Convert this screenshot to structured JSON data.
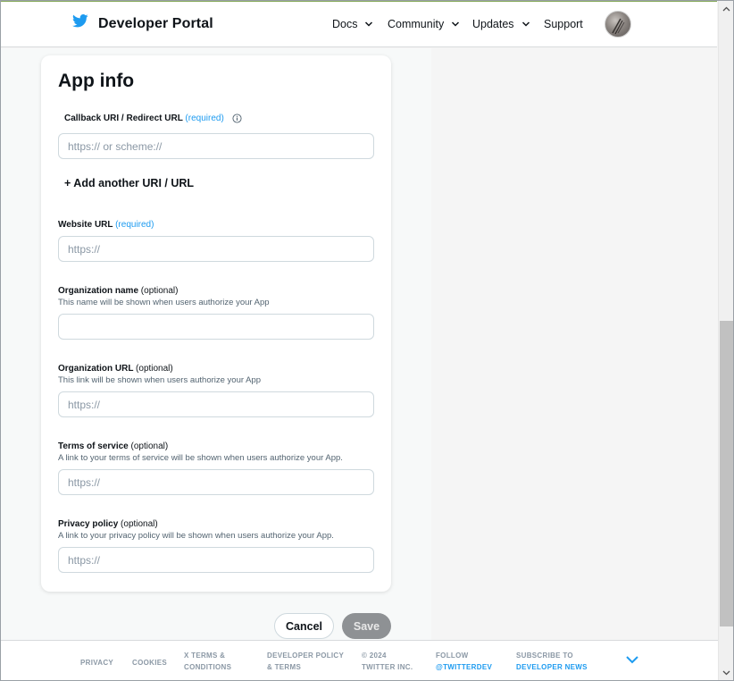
{
  "header": {
    "brand": "Developer Portal",
    "nav": [
      {
        "label": "Docs",
        "dropdown": true
      },
      {
        "label": "Community",
        "dropdown": true
      },
      {
        "label": "Updates",
        "dropdown": true
      },
      {
        "label": "Support",
        "dropdown": false
      }
    ],
    "logo_icon": "twitter-bird-icon",
    "avatar_icon": "user-avatar"
  },
  "form": {
    "title": "App info",
    "callback": {
      "label": "Callback URI / Redirect URL",
      "required": "(required)",
      "placeholder": "https:// or scheme://",
      "value": "",
      "info_icon": "info-icon"
    },
    "add_another": "+ Add another URI / URL",
    "website": {
      "label": "Website URL",
      "required": "(required)",
      "placeholder": "https://",
      "value": ""
    },
    "org_name": {
      "label": "Organization name",
      "optional": "(optional)",
      "help": "This name will be shown when users authorize your App",
      "placeholder": "",
      "value": ""
    },
    "org_url": {
      "label": "Organization URL",
      "optional": "(optional)",
      "help": "This link will be shown when users authorize your App",
      "placeholder": "https://",
      "value": ""
    },
    "tos": {
      "label": "Terms of service",
      "optional": "(optional)",
      "help": "A link to your terms of service will be shown when users authorize your App.",
      "placeholder": "https://",
      "value": ""
    },
    "privacy": {
      "label": "Privacy policy",
      "optional": "(optional)",
      "help": "A link to your privacy policy will be shown when users authorize your App.",
      "placeholder": "https://",
      "value": ""
    }
  },
  "actions": {
    "cancel": "Cancel",
    "save": "Save"
  },
  "footer": {
    "privacy": "PRIVACY",
    "cookies": "COOKIES",
    "x_terms_1": "X TERMS &",
    "x_terms_2": "CONDITIONS",
    "dev_policy_1": "DEVELOPER POLICY",
    "dev_policy_2": "& TERMS",
    "copyright_1": "© 2024",
    "copyright_2": "TWITTER INC.",
    "follow_1": "FOLLOW",
    "follow_2": "@TWITTERDEV",
    "subscribe_1": "SUBSCRIBE TO",
    "subscribe_2": "DEVELOPER NEWS",
    "chevron_icon": "chevron-down-icon"
  },
  "colors": {
    "accent_blue": "#1d9bf0",
    "save_disabled": "#8e9194",
    "text": "#0f1419",
    "muted": "#536471"
  }
}
